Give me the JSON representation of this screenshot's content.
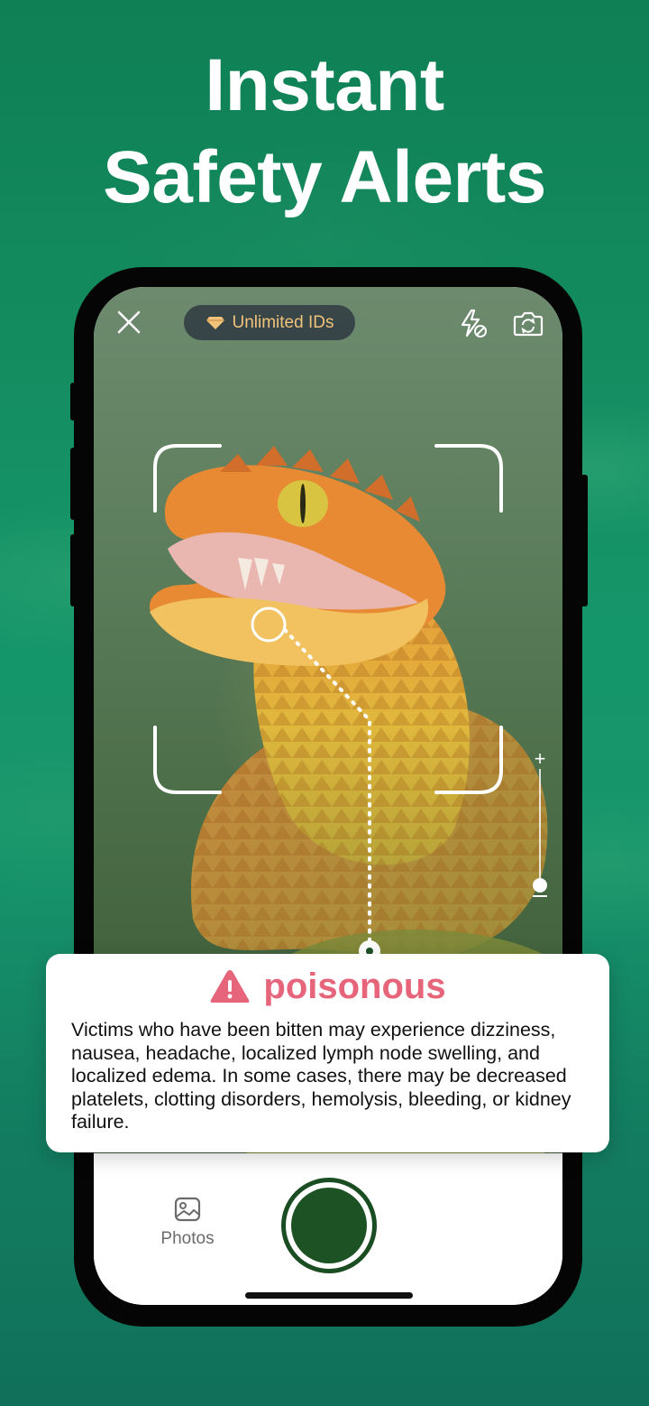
{
  "headline": {
    "line1": "Instant",
    "line2": "Safety Alerts"
  },
  "camera": {
    "close_icon": "close-icon",
    "subscription_pill": {
      "icon": "diamond-icon",
      "label": "Unlimited IDs"
    },
    "flash_icon": "flash-off-icon",
    "flip_icon": "flip-camera-icon",
    "zoom_plus": "+"
  },
  "alert": {
    "icon": "warning-icon",
    "title": "poisonous",
    "body": "Victims who have been bitten may experience dizziness, nausea, headache, localized lymph node swelling, and localized edema. In some cases, there may be decreased platelets, clotting disorders, hemolysis, bleeding, or kidney failure."
  },
  "bottom_bar": {
    "photos_label": "Photos"
  },
  "colors": {
    "background": "#138a5e",
    "alert_accent": "#e6657b",
    "shutter": "#1d5224",
    "pill_text": "#f1c27a"
  }
}
